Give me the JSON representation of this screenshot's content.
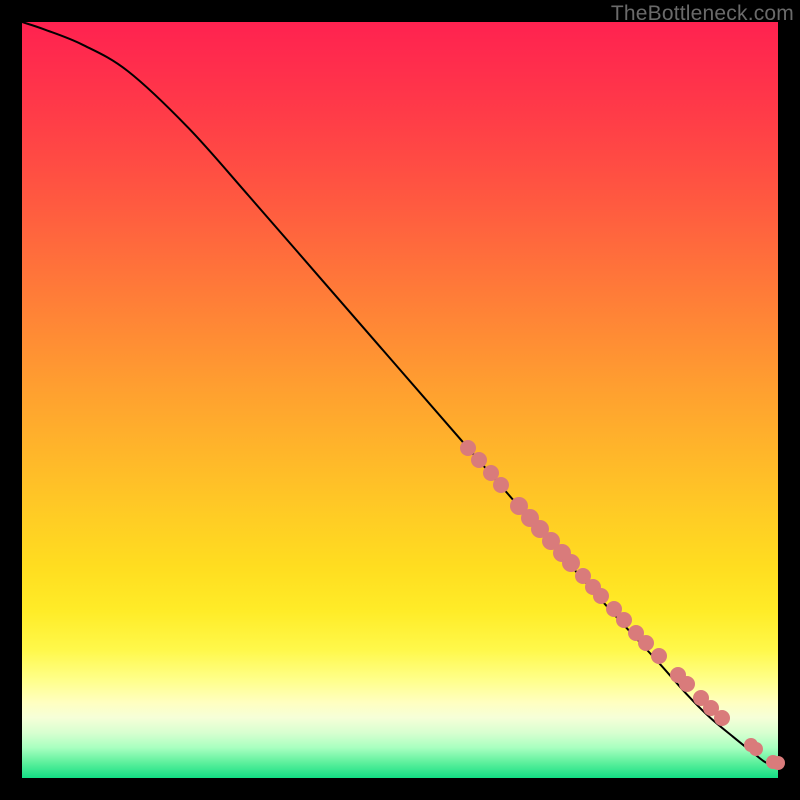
{
  "watermark": "TheBottleneck.com",
  "colors": {
    "point_fill": "#d97b7b",
    "curve_stroke": "#000000",
    "page_bg": "#000000"
  },
  "chart_data": {
    "type": "line",
    "title": "",
    "xlabel": "",
    "ylabel": "",
    "xlim": [
      0,
      100
    ],
    "ylim": [
      0,
      100
    ],
    "grid": false,
    "legend": false,
    "series": [
      {
        "name": "curve",
        "kind": "line",
        "x": [
          0,
          3,
          8,
          14,
          22,
          30,
          40,
          50,
          60,
          70,
          78,
          84,
          88,
          91,
          94,
          96.5,
          98.5,
          100
        ],
        "y": [
          100,
          99,
          97,
          93.5,
          86,
          77,
          65.5,
          54,
          42.5,
          31,
          22,
          15.5,
          11,
          8,
          5.5,
          3.5,
          2,
          2
        ]
      },
      {
        "name": "points",
        "kind": "scatter",
        "x": [
          59.0,
          60.5,
          62.0,
          63.3,
          65.8,
          67.2,
          68.5,
          70.0,
          71.4,
          72.6,
          74.2,
          75.5,
          76.6,
          78.3,
          79.6,
          81.2,
          82.5,
          84.2,
          86.8,
          88.0,
          89.8,
          91.2,
          92.6,
          96.4,
          97.1,
          99.4,
          100.0
        ],
        "y": [
          43.7,
          42.0,
          40.3,
          38.8,
          36.0,
          34.4,
          33.0,
          31.3,
          29.7,
          28.4,
          26.7,
          25.3,
          24.1,
          22.3,
          20.9,
          19.2,
          17.9,
          16.2,
          13.6,
          12.4,
          10.6,
          9.2,
          7.9,
          4.4,
          3.8,
          2.1,
          2.0
        ],
        "r": [
          8,
          8,
          8,
          8,
          9,
          9,
          9,
          9,
          9,
          9,
          8,
          8,
          8,
          8,
          8,
          8,
          8,
          8,
          8,
          8,
          8,
          8,
          8,
          7,
          7,
          7,
          7
        ]
      }
    ]
  }
}
